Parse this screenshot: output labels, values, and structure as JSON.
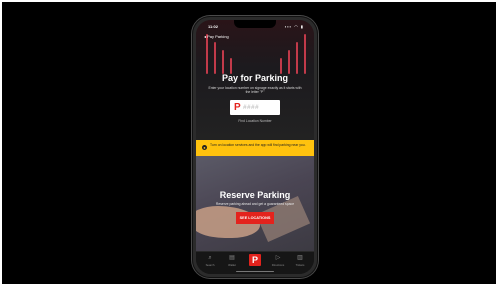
{
  "status": {
    "time": "11:02",
    "signal": "▪▪▪ ◠ ▮"
  },
  "nav": {
    "back": "◂ Pay Parking"
  },
  "pay": {
    "title": "Pay for Parking",
    "subtitle": "Enter your location number on signage exactly as it starts with the letter \"P\"",
    "zone_prefix": "P",
    "zone_placeholder": "####",
    "find_zone": "Find Location Number"
  },
  "notice": {
    "icon": "location-pin-icon",
    "text": "Turn on location services and the app will find parking near you."
  },
  "reserve": {
    "title": "Reserve Parking",
    "subtitle": "Reserve parking ahead and get a guaranteed space",
    "button": "SEE LOCATIONS"
  },
  "tabs": [
    {
      "icon": "search-icon",
      "label": "Search"
    },
    {
      "icon": "wallet-icon",
      "label": "Wallet"
    },
    {
      "icon": "parking-icon",
      "label": "P"
    },
    {
      "icon": "directions-icon",
      "label": "Directions"
    },
    {
      "icon": "tickets-icon",
      "label": "Tickets"
    }
  ],
  "colors": {
    "accent": "#e3231d",
    "notice": "#ffc20e",
    "background": "#000000"
  }
}
